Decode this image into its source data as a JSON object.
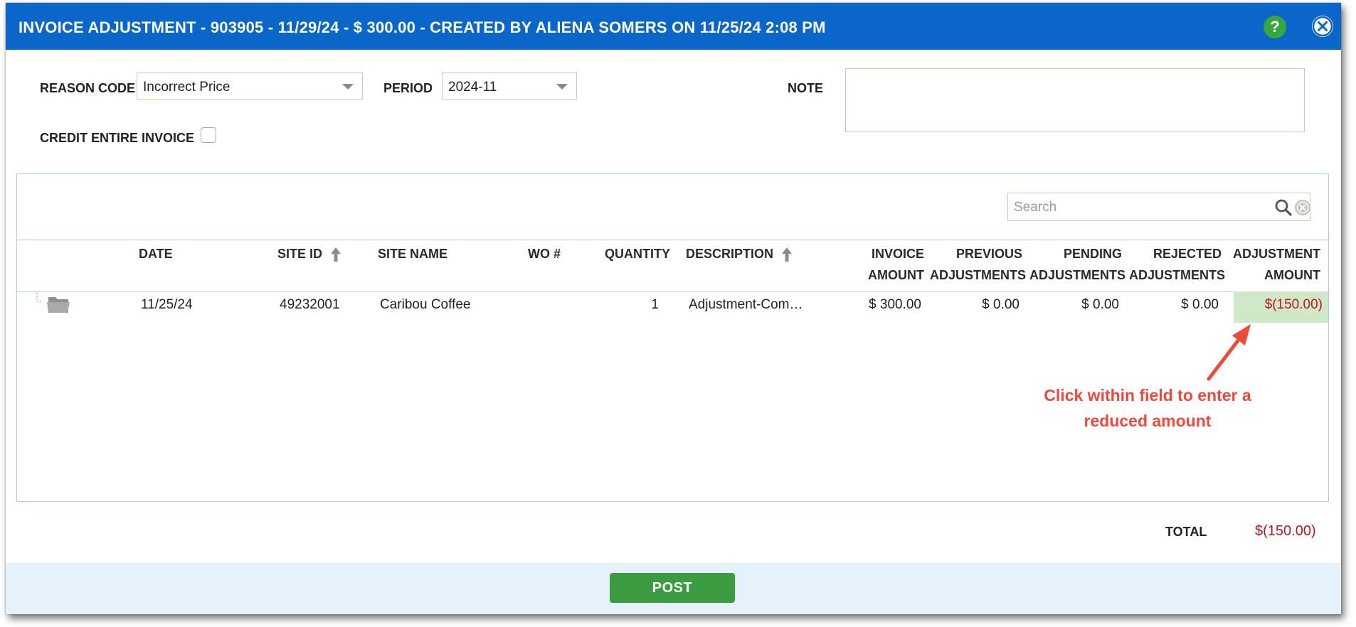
{
  "dialog": {
    "title": "INVOICE ADJUSTMENT - 903905 - 11/29/24 - $ 300.00 - CREATED BY ALIENA SOMERS ON 11/25/24 2:08 PM",
    "help_label": "?"
  },
  "form": {
    "reason_code_label": "REASON CODE",
    "reason_code_value": "Incorrect Price",
    "period_label": "PERIOD",
    "period_value": "2024-11",
    "note_label": "NOTE",
    "credit_entire_invoice_label": "CREDIT ENTIRE INVOICE",
    "credit_entire_invoice_checked": false
  },
  "search": {
    "placeholder": "Search"
  },
  "table": {
    "columns": {
      "date": "DATE",
      "site_id": "SITE ID",
      "site_name": "SITE NAME",
      "wo": "WO #",
      "quantity": "QUANTITY",
      "description": "DESCRIPTION",
      "invoice_amount_1": "INVOICE",
      "invoice_amount_2": "AMOUNT",
      "previous_adjustments_1": "PREVIOUS",
      "previous_adjustments_2": "ADJUSTMENTS",
      "pending_adjustments_1": "PENDING",
      "pending_adjustments_2": "ADJUSTMENTS",
      "rejected_adjustments_1": "REJECTED",
      "rejected_adjustments_2": "ADJUSTMENTS",
      "adjustment_amount_1": "ADJUSTMENT",
      "adjustment_amount_2": "AMOUNT"
    },
    "rows": [
      {
        "date": "11/25/24",
        "site_id": "49232001",
        "site_name": "Caribou Coffee",
        "wo": "",
        "quantity": "1",
        "description": "Adjustment-Com…",
        "invoice_amount": "$ 300.00",
        "previous_adjustments": "$ 0.00",
        "pending_adjustments": "$ 0.00",
        "rejected_adjustments": "$ 0.00",
        "adjustment_amount": "$(150.00)"
      }
    ]
  },
  "annotation": {
    "line1": "Click within field to enter a",
    "line2": "reduced amount",
    "color": "#f0483a"
  },
  "totals": {
    "label": "TOTAL",
    "value": "$(150.00)"
  },
  "footer": {
    "post_label": "POST"
  },
  "colors": {
    "titlebar": "#0a66c8",
    "post_button": "#3a9b40",
    "negative_amount": "#c0141e",
    "adjustment_cell_bg": "#cfe8c8"
  }
}
